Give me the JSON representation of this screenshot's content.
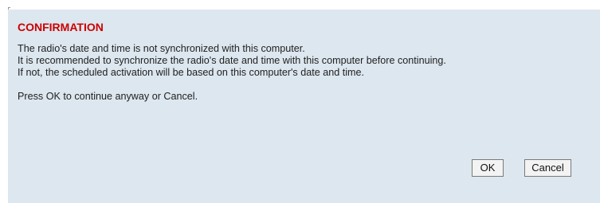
{
  "dialog": {
    "title": "CONFIRMATION",
    "lines": [
      "The radio's date and time is not synchronized with this computer.",
      "It is recommended to synchronize the radio's date and time with this computer before continuing.",
      "If not, the scheduled activation will be based on this computer's date and time.",
      "Press OK to continue anyway or Cancel."
    ],
    "buttons": {
      "ok_label": "OK",
      "cancel_label": "Cancel"
    }
  },
  "colors": {
    "background": "#dde7ef",
    "title": "#cc0000",
    "text": "#222222"
  }
}
